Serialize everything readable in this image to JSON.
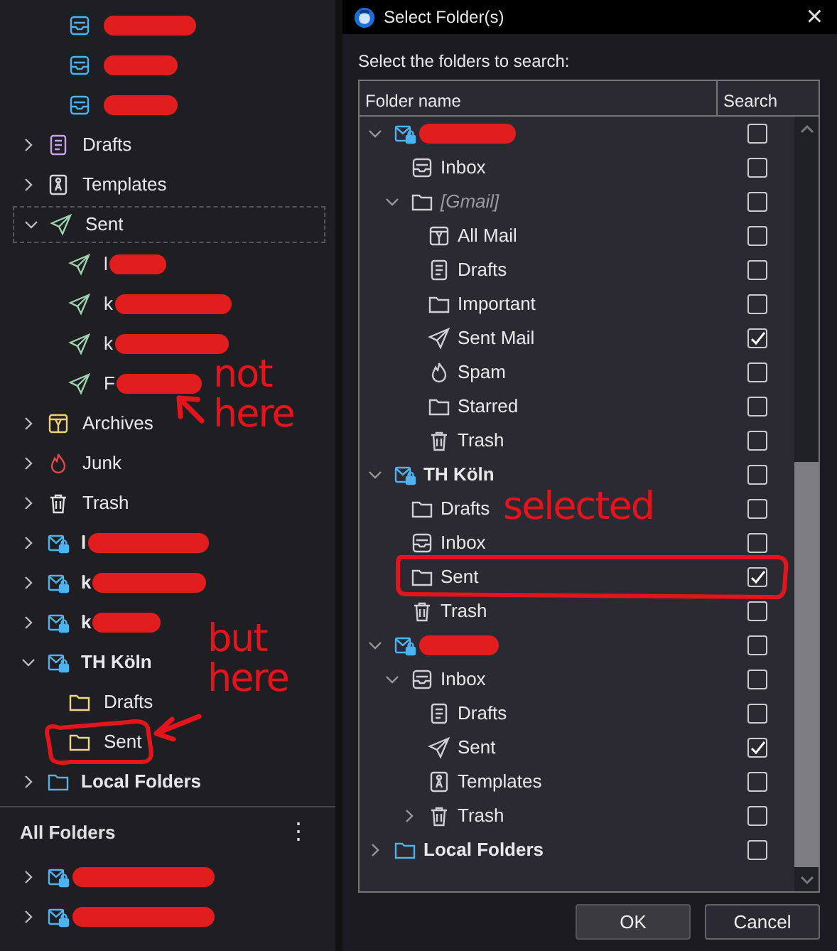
{
  "folder_pane": {
    "tree": [
      {
        "children": [
          {
            "kind": "inbox",
            "redacted": true
          },
          {
            "kind": "inbox",
            "redacted": true
          },
          {
            "kind": "inbox",
            "redacted": true
          }
        ]
      },
      {
        "kind": "drafts",
        "label": "Drafts",
        "expanded": false
      },
      {
        "kind": "templates",
        "label": "Templates",
        "expanded": false
      },
      {
        "kind": "sent",
        "label": "Sent",
        "expanded": true,
        "focused": true,
        "children": [
          {
            "kind": "sent",
            "label": "l",
            "redacted": true
          },
          {
            "kind": "sent",
            "label": "k",
            "redacted": true
          },
          {
            "kind": "sent",
            "label": "k",
            "redacted": true
          },
          {
            "kind": "sent",
            "label": "F",
            "redacted": true
          }
        ]
      },
      {
        "kind": "archives",
        "label": "Archives",
        "expanded": false
      },
      {
        "kind": "junk",
        "label": "Junk",
        "expanded": false
      },
      {
        "kind": "trash",
        "label": "Trash",
        "expanded": false
      },
      {
        "kind": "account",
        "label": "l",
        "bold": true,
        "redacted": true,
        "expanded": false
      },
      {
        "kind": "account",
        "label": "k",
        "bold": true,
        "redacted": true,
        "expanded": false
      },
      {
        "kind": "account",
        "label": "k",
        "bold": true,
        "redacted": true,
        "expanded": false
      },
      {
        "kind": "account",
        "label": "TH Köln",
        "bold": true,
        "expanded": true,
        "children": [
          {
            "kind": "folder",
            "label": "Drafts"
          },
          {
            "kind": "folder",
            "label": "Sent"
          }
        ]
      },
      {
        "kind": "local",
        "label": "Local Folders",
        "bold": true,
        "expanded": false
      }
    ],
    "section": {
      "title": "All Folders",
      "menu": "⋮"
    },
    "section_tree": [
      {
        "kind": "account",
        "redacted": true,
        "expanded": false
      },
      {
        "kind": "account",
        "redacted": true,
        "expanded": false
      }
    ]
  },
  "dialog": {
    "title": "Select Folder(s)",
    "close": "×",
    "prompt": "Select the folders to search:",
    "columns": [
      "Folder name",
      "Search"
    ],
    "tree": [
      {
        "kind": "account",
        "redacted": true,
        "expanded": true,
        "checked": false,
        "children": [
          {
            "kind": "inbox",
            "label": "Inbox",
            "checked": false
          },
          {
            "kind": "folder",
            "label": "[Gmail]",
            "italic": true,
            "expanded": true,
            "checked": false,
            "children": [
              {
                "kind": "allmail",
                "label": "All Mail",
                "checked": false
              },
              {
                "kind": "drafts",
                "label": "Drafts",
                "checked": false
              },
              {
                "kind": "folder",
                "label": "Important",
                "checked": false
              },
              {
                "kind": "sent",
                "label": "Sent Mail",
                "checked": true
              },
              {
                "kind": "junk",
                "label": "Spam",
                "checked": false
              },
              {
                "kind": "folder",
                "label": "Starred",
                "checked": false
              },
              {
                "kind": "trash",
                "label": "Trash",
                "checked": false
              }
            ]
          }
        ]
      },
      {
        "kind": "account",
        "label": "TH Köln",
        "bold": true,
        "expanded": true,
        "checked": false,
        "children": [
          {
            "kind": "folder",
            "label": "Drafts",
            "checked": false
          },
          {
            "kind": "inbox",
            "label": "Inbox",
            "checked": false
          },
          {
            "kind": "folder",
            "label": "Sent",
            "checked": true
          },
          {
            "kind": "trash",
            "label": "Trash",
            "checked": false
          }
        ]
      },
      {
        "kind": "account",
        "redacted": true,
        "expanded": true,
        "checked": false,
        "children": [
          {
            "kind": "inbox",
            "label": "Inbox",
            "expanded": true,
            "checked": false,
            "children": [
              {
                "kind": "drafts",
                "label": "Drafts",
                "checked": false
              },
              {
                "kind": "sent",
                "label": "Sent",
                "checked": true
              },
              {
                "kind": "templates",
                "label": "Templates",
                "checked": false
              },
              {
                "kind": "trash",
                "label": "Trash",
                "expanded": false,
                "checked": false
              }
            ]
          }
        ]
      },
      {
        "kind": "local",
        "label": "Local Folders",
        "bold": true,
        "expanded": false,
        "checked": false
      }
    ],
    "buttons": [
      "OK",
      "Cancel"
    ]
  },
  "annotations": [
    {
      "kind": "note",
      "text": "not here"
    },
    {
      "kind": "note",
      "text": "selected"
    },
    {
      "kind": "note",
      "text": "but here"
    }
  ]
}
